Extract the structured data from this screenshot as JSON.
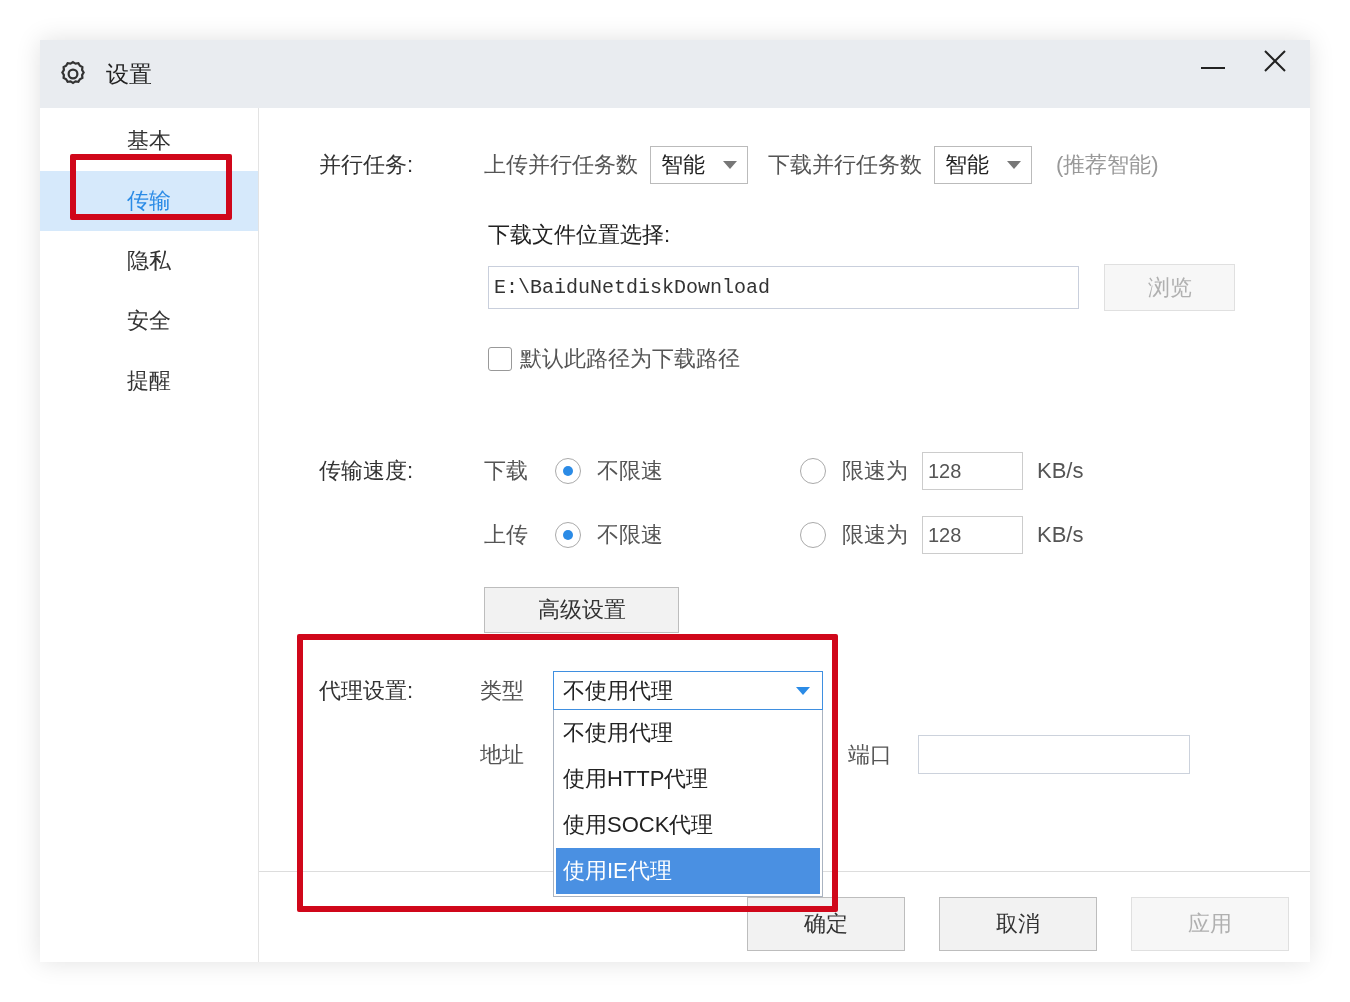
{
  "window": {
    "title": "设置"
  },
  "sidebar": {
    "items": [
      {
        "label": "基本",
        "selected": false,
        "highlighted": false
      },
      {
        "label": "传输",
        "selected": true,
        "highlighted": true
      },
      {
        "label": "隐私",
        "selected": false,
        "highlighted": false
      },
      {
        "label": "安全",
        "selected": false,
        "highlighted": false
      },
      {
        "label": "提醒",
        "selected": false,
        "highlighted": false
      }
    ]
  },
  "parallel": {
    "label": "并行任务:",
    "upload_label": "上传并行任务数",
    "upload_value": "智能",
    "download_label": "下载并行任务数",
    "download_value": "智能",
    "hint": "(推荐智能)"
  },
  "location": {
    "label": "下载文件位置选择:",
    "path": "E:\\BaiduNetdiskDownload",
    "browse": "浏览",
    "browse_disabled": true,
    "default_label": "默认此路径为下载路径",
    "default_checked": false
  },
  "speed": {
    "label": "传输速度:",
    "rows": [
      {
        "label": "下载",
        "options": [
          {
            "label": "不限速",
            "selected": true
          },
          {
            "label": "限速为",
            "selected": false
          }
        ],
        "limit": "128",
        "unit": "KB/s"
      },
      {
        "label": "上传",
        "options": [
          {
            "label": "不限速",
            "selected": true
          },
          {
            "label": "限速为",
            "selected": false
          }
        ],
        "limit": "128",
        "unit": "KB/s"
      }
    ]
  },
  "advanced_button": "高级设置",
  "proxy": {
    "label": "代理设置:",
    "highlighted": true,
    "type_label": "类型",
    "type_value": "不使用代理",
    "expanded": true,
    "options": [
      {
        "label": "不使用代理",
        "selected": false
      },
      {
        "label": "使用HTTP代理",
        "selected": false
      },
      {
        "label": "使用SOCK代理",
        "selected": false
      },
      {
        "label": "使用IE代理",
        "selected": true
      }
    ],
    "address_label": "地址",
    "port_label": "端口"
  },
  "footer_buttons": [
    {
      "label": "确定",
      "disabled": false
    },
    {
      "label": "取消",
      "disabled": false
    },
    {
      "label": "应用",
      "disabled": true
    }
  ]
}
